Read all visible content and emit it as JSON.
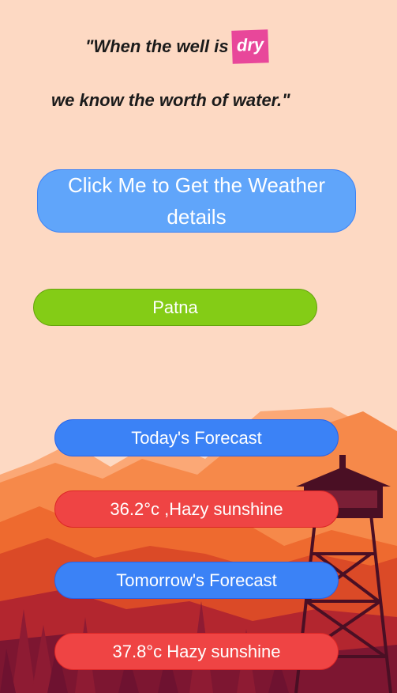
{
  "quote": {
    "line1_prefix": "\"When the well is",
    "highlight_word": "dry",
    "line2": "we know the worth of water.\""
  },
  "actions": {
    "weather_button_label": "Click Me to Get the Weather details",
    "city_button_label": "Patna"
  },
  "forecast": {
    "today_label": "Today's Forecast",
    "today_value": "36.2°c ,Hazy sunshine",
    "tomorrow_label": "Tomorrow's Forecast",
    "tomorrow_value": "37.8°c Hazy sunshine"
  },
  "colors": {
    "background": "#fdd9c3",
    "highlight": "#e8479a",
    "weather_button": "#60a5fa",
    "city_button": "#84cc16",
    "forecast_label": "#3b82f6",
    "forecast_value": "#ef4444"
  },
  "icons": {
    "background_illustration": "mountain-firewatch-tower-scene"
  }
}
